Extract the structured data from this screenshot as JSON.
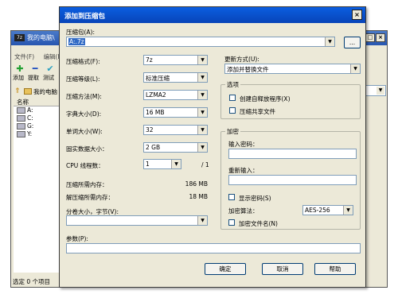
{
  "background_window": {
    "title": "我的电脑\\",
    "app_icon": "7z",
    "caption_buttons": [
      "□",
      "×"
    ],
    "menu": [
      "文件(F)",
      "编辑(E)"
    ],
    "toolbar": [
      {
        "label": "添加",
        "icon": "add-icon",
        "color": "#22a032"
      },
      {
        "label": "提取",
        "icon": "extract-icon",
        "color": "#2050c0"
      },
      {
        "label": "测试",
        "icon": "test-icon",
        "color": "#2aa0c0"
      }
    ],
    "address_text": "我的电脑",
    "list_header": "名称",
    "drives": [
      "A:",
      "C:",
      "G:",
      "Y:"
    ],
    "status": "选定 0 个项目"
  },
  "dialog": {
    "title": "添加到压缩包",
    "close_glyph": "×",
    "archive": {
      "label": "压缩包(A):",
      "value": "A:.7z",
      "browse_label": "..."
    },
    "left": {
      "format": {
        "label": "压缩格式(F):",
        "value": "7z"
      },
      "level": {
        "label": "压缩等级(L):",
        "value": "标准压缩"
      },
      "method": {
        "label": "压缩方法(M):",
        "value": "LZMA2"
      },
      "dict": {
        "label": "字典大小(D):",
        "value": "16 MB"
      },
      "word": {
        "label": "单词大小(W):",
        "value": "32"
      },
      "solid": {
        "label": "固实数据大小：",
        "value": "2 GB"
      },
      "threads": {
        "label": "CPU 线程数：",
        "value": "1",
        "max": "/ 1"
      },
      "mem_compress": {
        "label": "压缩所需内存：",
        "value": "186 MB"
      },
      "mem_decompress": {
        "label": "解压缩所需内存：",
        "value": "18 MB"
      },
      "split": {
        "label": "分卷大小，字节(V):",
        "value": ""
      },
      "params": {
        "label": "参数(P):",
        "value": ""
      }
    },
    "right": {
      "update": {
        "label": "更新方式(U):",
        "value": "添加并替换文件"
      },
      "options": {
        "title": "选项",
        "sfx_label": "创建自释放程序(X)",
        "shared_label": "压缩共享文件"
      },
      "encryption": {
        "title": "加密",
        "password_label": "输入密码：",
        "reenter_label": "重新输入：",
        "show_label": "显示密码(S)",
        "method_label": "加密算法：",
        "method_value": "AES-256",
        "encrypt_names_label": "加密文件名(N)"
      }
    },
    "buttons": {
      "ok": "确定",
      "cancel": "取消",
      "help": "帮助"
    },
    "dropdown_glyph": "▼"
  }
}
